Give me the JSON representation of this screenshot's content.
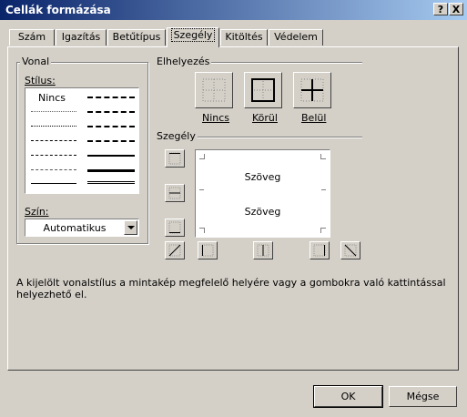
{
  "window": {
    "title": "Cellák formázása",
    "help_label": "?",
    "close_label": "X"
  },
  "tabs": [
    {
      "label": "Szám"
    },
    {
      "label": "Igazítás"
    },
    {
      "label": "Betűtípus"
    },
    {
      "label": "Szegély",
      "active": true
    },
    {
      "label": "Kitöltés"
    },
    {
      "label": "Védelem"
    }
  ],
  "line_group": {
    "legend": "Vonal",
    "style_label": "Stílus:",
    "none_label": "Nincs",
    "color_label": "Szín:",
    "color_value": "Automatikus"
  },
  "presets": {
    "heading": "Elhelyezés",
    "none_label": "Nincs",
    "outline_label": "Körül",
    "inside_label": "Belül"
  },
  "border": {
    "heading": "Szegély",
    "preview_text_top": "Szöveg",
    "preview_text_bottom": "Szöveg"
  },
  "hint": "A kijelölt vonalstílus a mintakép megfelelő helyére vagy a gombokra való kattintással helyezhető el.",
  "buttons": {
    "ok": "OK",
    "cancel": "Mégse"
  }
}
